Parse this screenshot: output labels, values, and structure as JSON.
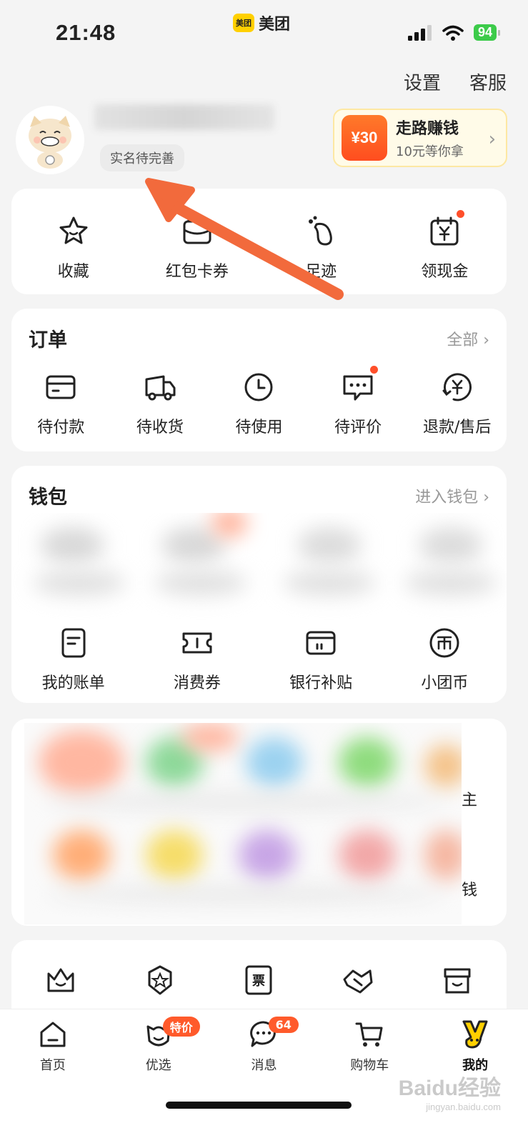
{
  "status_bar": {
    "time": "21:48",
    "battery": "94"
  },
  "app": {
    "logo_text": "美团",
    "name": "美团"
  },
  "top_links": {
    "settings": "设置",
    "service": "客服"
  },
  "profile": {
    "verify_tag": "实名待完善"
  },
  "walk_card": {
    "badge": "¥30",
    "title": "走路赚钱",
    "subtitle": "10元等你拿"
  },
  "quick_actions": [
    {
      "label": "收藏",
      "icon": "star-icon"
    },
    {
      "label": "红包卡券",
      "icon": "wallet-card-icon"
    },
    {
      "label": "足迹",
      "icon": "footprint-icon"
    },
    {
      "label": "领现金",
      "icon": "calendar-yen-icon"
    }
  ],
  "orders": {
    "title": "订单",
    "more": "全部",
    "items": [
      {
        "label": "待付款",
        "icon": "card-icon"
      },
      {
        "label": "待收货",
        "icon": "truck-icon"
      },
      {
        "label": "待使用",
        "icon": "clock-icon"
      },
      {
        "label": "待评价",
        "icon": "comment-icon"
      },
      {
        "label": "退款/售后",
        "icon": "refund-icon"
      }
    ]
  },
  "wallet": {
    "title": "钱包",
    "more": "进入钱包",
    "items": [
      {
        "label": "我的账单",
        "icon": "bill-icon"
      },
      {
        "label": "消费券",
        "icon": "ticket-icon"
      },
      {
        "label": "银行补贴",
        "icon": "bank-card-icon"
      },
      {
        "label": "小团币",
        "icon": "coin-icon"
      }
    ]
  },
  "services": {
    "partial_labels": [
      "主",
      "钱"
    ]
  },
  "bottom_nav": [
    {
      "label": "首页",
      "icon": "home-icon"
    },
    {
      "label": "优选",
      "icon": "youxuan-icon",
      "badge": "特价"
    },
    {
      "label": "消息",
      "icon": "message-icon",
      "badge": "64"
    },
    {
      "label": "购物车",
      "icon": "cart-icon"
    },
    {
      "label": "我的",
      "icon": "mine-icon"
    }
  ],
  "watermark": {
    "text": "Baidu经验",
    "sub": "jingyan.baidu.com"
  },
  "colors": {
    "accent": "#ffd000",
    "badge": "#ff5a2b",
    "arrow": "#f26a3c"
  }
}
